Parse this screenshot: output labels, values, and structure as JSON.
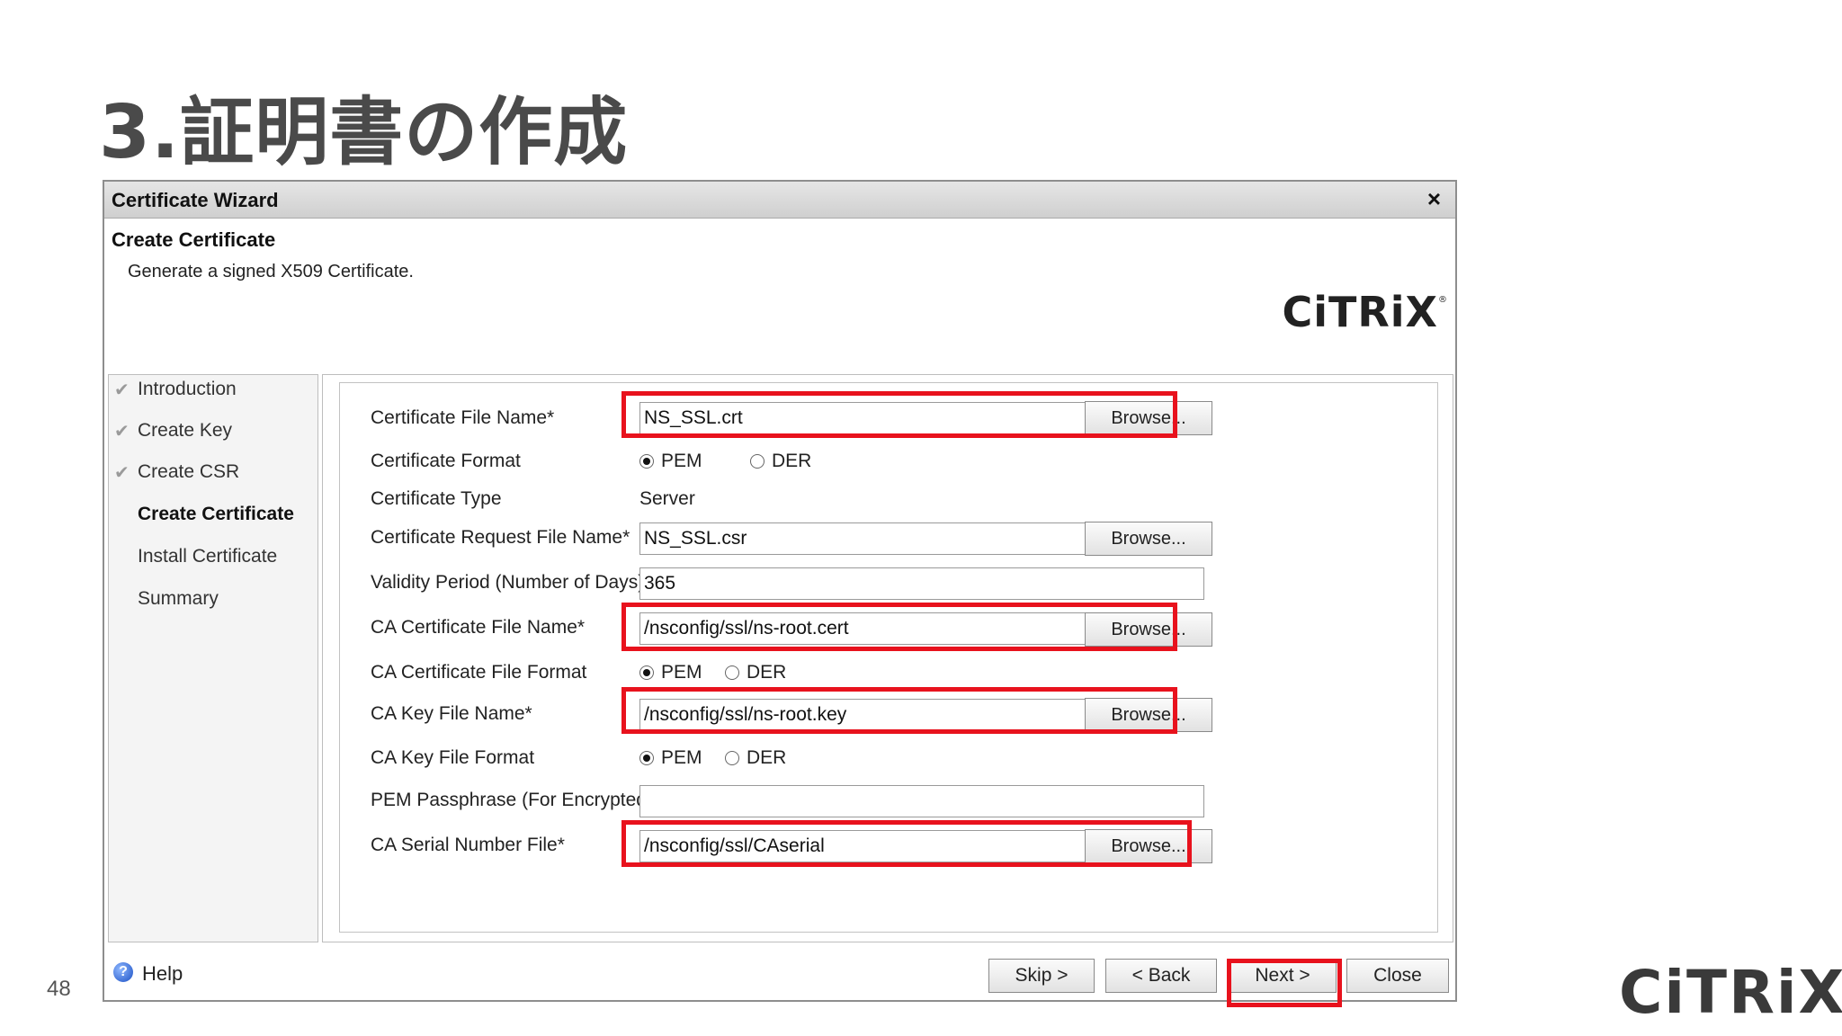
{
  "slide": {
    "title": "3.証明書の作成",
    "page_number": "48",
    "brand": "CiTRiX",
    "brand_mark": "®"
  },
  "dialog": {
    "title": "Certificate Wizard",
    "close_glyph": "×",
    "header_title": "Create Certificate",
    "header_subtitle": "Generate a signed X509 Certificate.",
    "logo": "CiTRiX",
    "logo_mark": "®",
    "steps": [
      {
        "label": "Introduction",
        "done": true
      },
      {
        "label": "Create Key",
        "done": true
      },
      {
        "label": "Create CSR",
        "done": true
      },
      {
        "label": "Create Certificate",
        "active": true
      },
      {
        "label": "Install Certificate"
      },
      {
        "label": "Summary"
      }
    ],
    "check_glyph": "✔",
    "form": {
      "cert_file_name": {
        "label": "Certificate File Name*",
        "value": "NS_SSL.crt"
      },
      "cert_format": {
        "label": "Certificate Format",
        "options": [
          "PEM",
          "DER"
        ],
        "selected": "PEM"
      },
      "cert_type": {
        "label": "Certificate Type",
        "value": "Server"
      },
      "csr_file_name": {
        "label": "Certificate Request File Name*",
        "value": "NS_SSL.csr"
      },
      "validity": {
        "label": "Validity Period (Number of Days)",
        "value": "365"
      },
      "ca_cert_file_name": {
        "label": "CA Certificate File Name*",
        "value": "/nsconfig/ssl/ns-root.cert"
      },
      "ca_cert_format": {
        "label": "CA Certificate File Format",
        "options": [
          "PEM",
          "DER"
        ],
        "selected": "PEM"
      },
      "ca_key_file_name": {
        "label": "CA Key File Name*",
        "value": "/nsconfig/ssl/ns-root.key"
      },
      "ca_key_format": {
        "label": "CA Key File Format",
        "options": [
          "PEM",
          "DER"
        ],
        "selected": "PEM"
      },
      "pem_passphrase": {
        "label": "PEM Passphrase (For Encrypted CA Key)",
        "value": ""
      },
      "ca_serial_file": {
        "label": "CA Serial Number File*",
        "value": "/nsconfig/ssl/CAserial"
      },
      "browse_label": "Browse..."
    },
    "footer": {
      "help_glyph": "?",
      "help": "Help",
      "skip": "Skip >",
      "back": "< Back",
      "next": "Next >",
      "close": "Close"
    }
  },
  "colors": {
    "highlight": "#e8121d"
  }
}
